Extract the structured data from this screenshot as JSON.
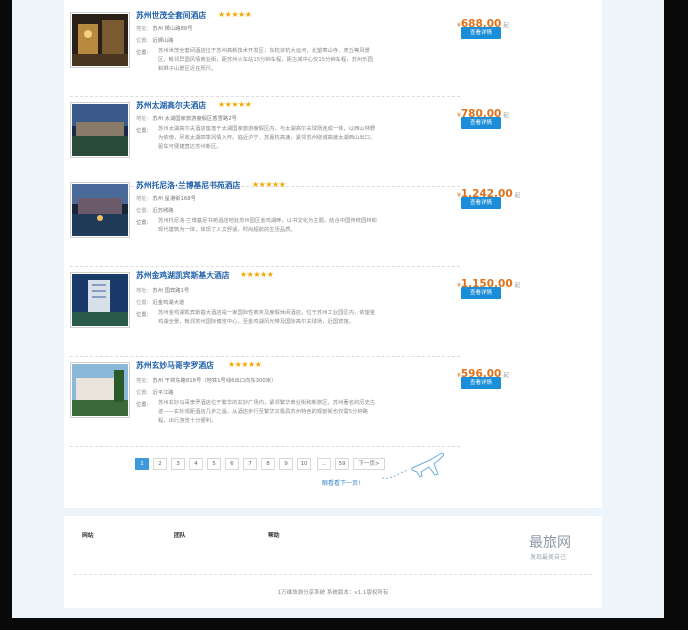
{
  "hotels": [
    {
      "name": "苏州世茂全套间酒店",
      "stars": "★★★★★",
      "price_currency": "¥",
      "price": "688.00",
      "price_unit": "起",
      "detail_label": "查看详情",
      "address_label": "地址:",
      "address": "苏州 狮山路88号",
      "location_label": "位置:",
      "location": "近狮山路",
      "desc_label": "位置:",
      "description": "苏州世茂全套间酒店位于苏州高新技术开发区，东枕京杭大运河，北望寒山寺、虎丘等风景区，毗邻异国风情商业街，距苏州火车站15分钟车程，距古城中心仅15分钟车程，苏州乐园和狮子山景区近在咫尺。"
    },
    {
      "name": "苏州太湖高尔夫酒店",
      "stars": "★★★★★",
      "price_currency": "¥",
      "price": "780.00",
      "price_unit": "起",
      "detail_label": "查看详情",
      "address_label": "地址:",
      "address": "苏州 太湖国家旅游度假区香雪路2号",
      "location_label": "位置:",
      "location": "",
      "desc_label": "位置:",
      "description": "苏州太湖高尔夫酒店座落于太湖国家旅游度假区内，与太湖高尔夫球场连成一体，以西山林野为依傍，尽收太湖四季风情入怀。临近沪宁、苏嘉杭高速，紧邻苏州绕城高速太湖西山出口，驱车可便捷直达苏州新区。"
    },
    {
      "name": "苏州托尼洛·兰博基尼书苑酒店",
      "stars": "★★★★★",
      "price_currency": "¥",
      "price": "1,242.00",
      "price_unit": "起",
      "detail_label": "查看详情",
      "address_label": "地址:",
      "address": "苏州 星港街168号",
      "location_label": "位置:",
      "location": "近苏绣路",
      "desc_label": "位置:",
      "description": "苏州托尼洛·兰博基尼书苑酒店地处苏州园区金鸡湖畔，以书文化为主题，结合中国传统园林和现代建筑为一体，体现了人文舒适，时尚超前的生活品质。"
    },
    {
      "name": "苏州金鸡湖凯宾斯基大酒店",
      "stars": "★★★★★",
      "price_currency": "¥",
      "price": "1,150.00",
      "price_unit": "起",
      "detail_label": "查看详情",
      "address_label": "地址:",
      "address": "苏州 国宾路1号",
      "location_label": "位置:",
      "location": "近金鸡湖大道",
      "desc_label": "位置:",
      "description": "苏州金鸡湖凯宾斯基大酒店是一家国际性商务及度假休闲酒店，位于苏州工业园区内，依望金鸡湖全景，毗邻苏州国际博览中心，至金鸡湖风光带及国际高尔夫球场，近国宾馆。"
    },
    {
      "name": "苏州玄妙马哥孛罗酒店",
      "stars": "★★★★★",
      "price_currency": "¥",
      "price": "596.00",
      "price_unit": "起",
      "detail_label": "查看详情",
      "address_label": "地址:",
      "address": "苏州 干将东路818号（地铁1号线6出口向东300米）",
      "location_label": "位置:",
      "location": "近平江路",
      "desc_label": "位置:",
      "description": "苏州玄妙马哥孛罗酒店位于繁华的玄妙广场内，紧邻繁华商业街和新旅区，苏州著名的历史古迹——玄妙观距酒店几步之遥，从酒店步行至繁华又极具苏州特色的观前街也仅需5分钟路程，出行游览十分便利。"
    }
  ],
  "pagination": {
    "pages": [
      "1",
      "2",
      "3",
      "4",
      "5",
      "6",
      "7",
      "8",
      "9",
      "10",
      "...",
      "59"
    ],
    "next": "下一页>",
    "active": "1",
    "hint": "眼看看下一页!"
  },
  "footer": {
    "links": [
      "网站",
      "团队",
      "帮助"
    ],
    "logo": "最旅网",
    "slogan": "发现最美自己",
    "copyright": "1万维旅游分享系统 系统版本：v1.1版权所有"
  },
  "colors": {
    "accent": "#1a8ed8",
    "price": "#e0701a",
    "hotel_name": "#1f5fa8",
    "star": "#f5a800"
  }
}
